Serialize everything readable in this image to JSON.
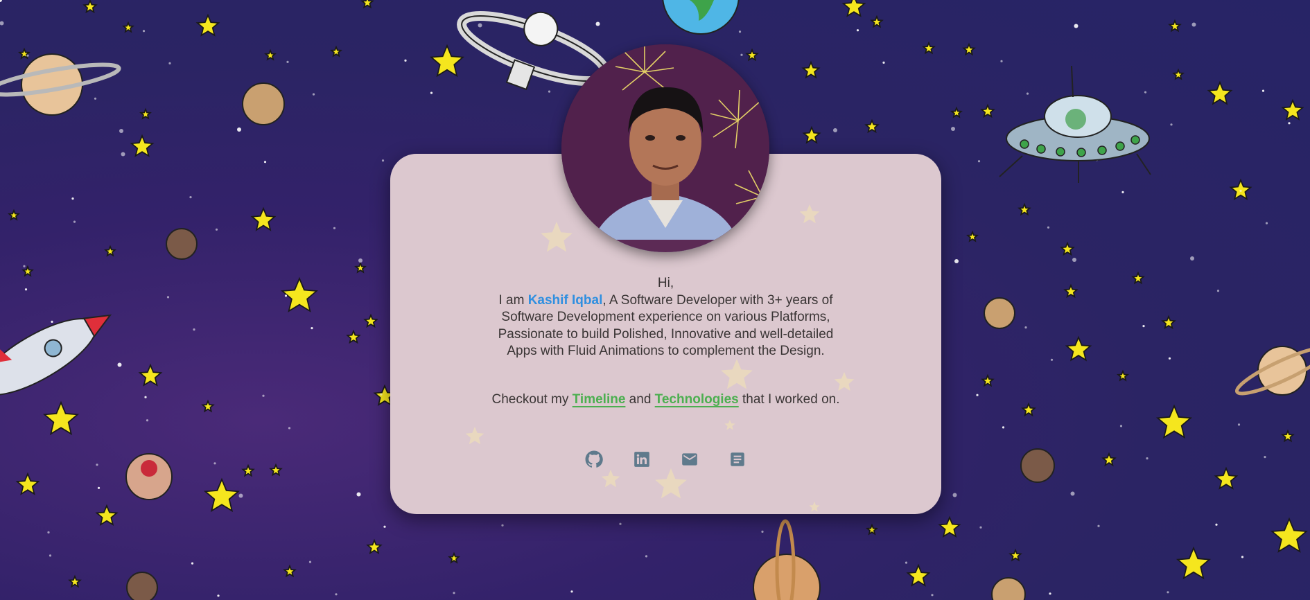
{
  "intro": {
    "greeting": "Hi,",
    "iam": "I am ",
    "name": "Kashif Iqbal",
    "line1_rest": ", A Software Developer with 3+ years of",
    "line2": "Software Development experience on various Platforms,",
    "line3": "Passionate to build Polished, Innovative and well-detailed",
    "line4": "Apps with Fluid Animations to complement the Design."
  },
  "checkout": {
    "prefix": "Checkout my ",
    "timeline_link": "Timeline",
    "and": " and ",
    "technologies_link": "Technologies",
    "suffix": " that I worked on."
  },
  "socials": [
    {
      "icon": "github-icon"
    },
    {
      "icon": "linkedin-icon"
    },
    {
      "icon": "email-icon"
    },
    {
      "icon": "resume-icon"
    }
  ],
  "colors": {
    "background": "#2b2464",
    "card": "#dcc8cf",
    "name": "#2f8fe0",
    "link": "#4caf50",
    "icon": "#5f7a8c",
    "star": "#f5e61e"
  }
}
